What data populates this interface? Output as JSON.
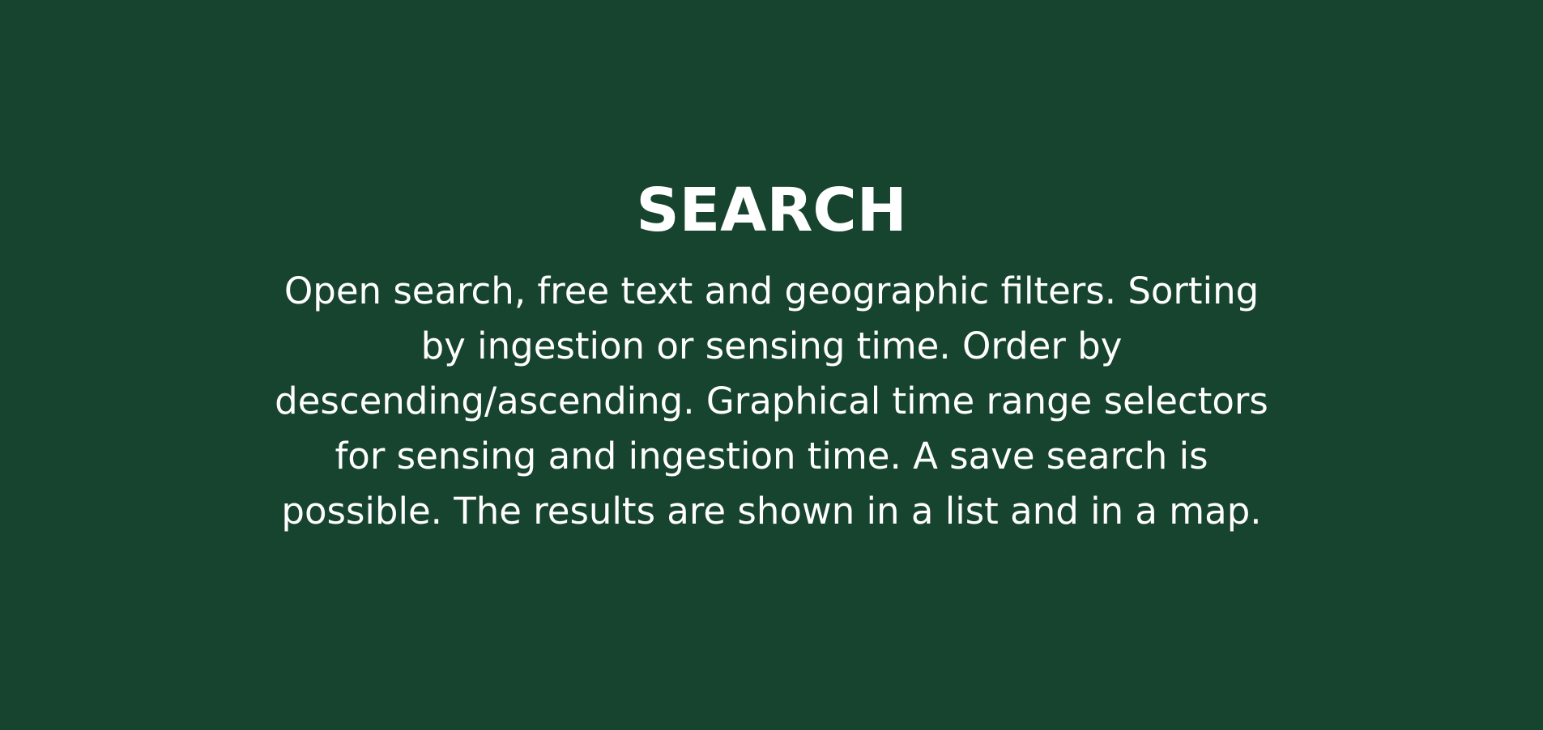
{
  "panel": {
    "title": "SEARCH",
    "description": "Open search, free text and geographic filters. Sorting by ingestion or sensing time. Order by descending/ascending. Graphical time range selectors for sensing and ingestion time. A save search is possible. The results are shown in a list and in a map."
  },
  "colors": {
    "background": "#17442e",
    "text": "#ffffff"
  }
}
